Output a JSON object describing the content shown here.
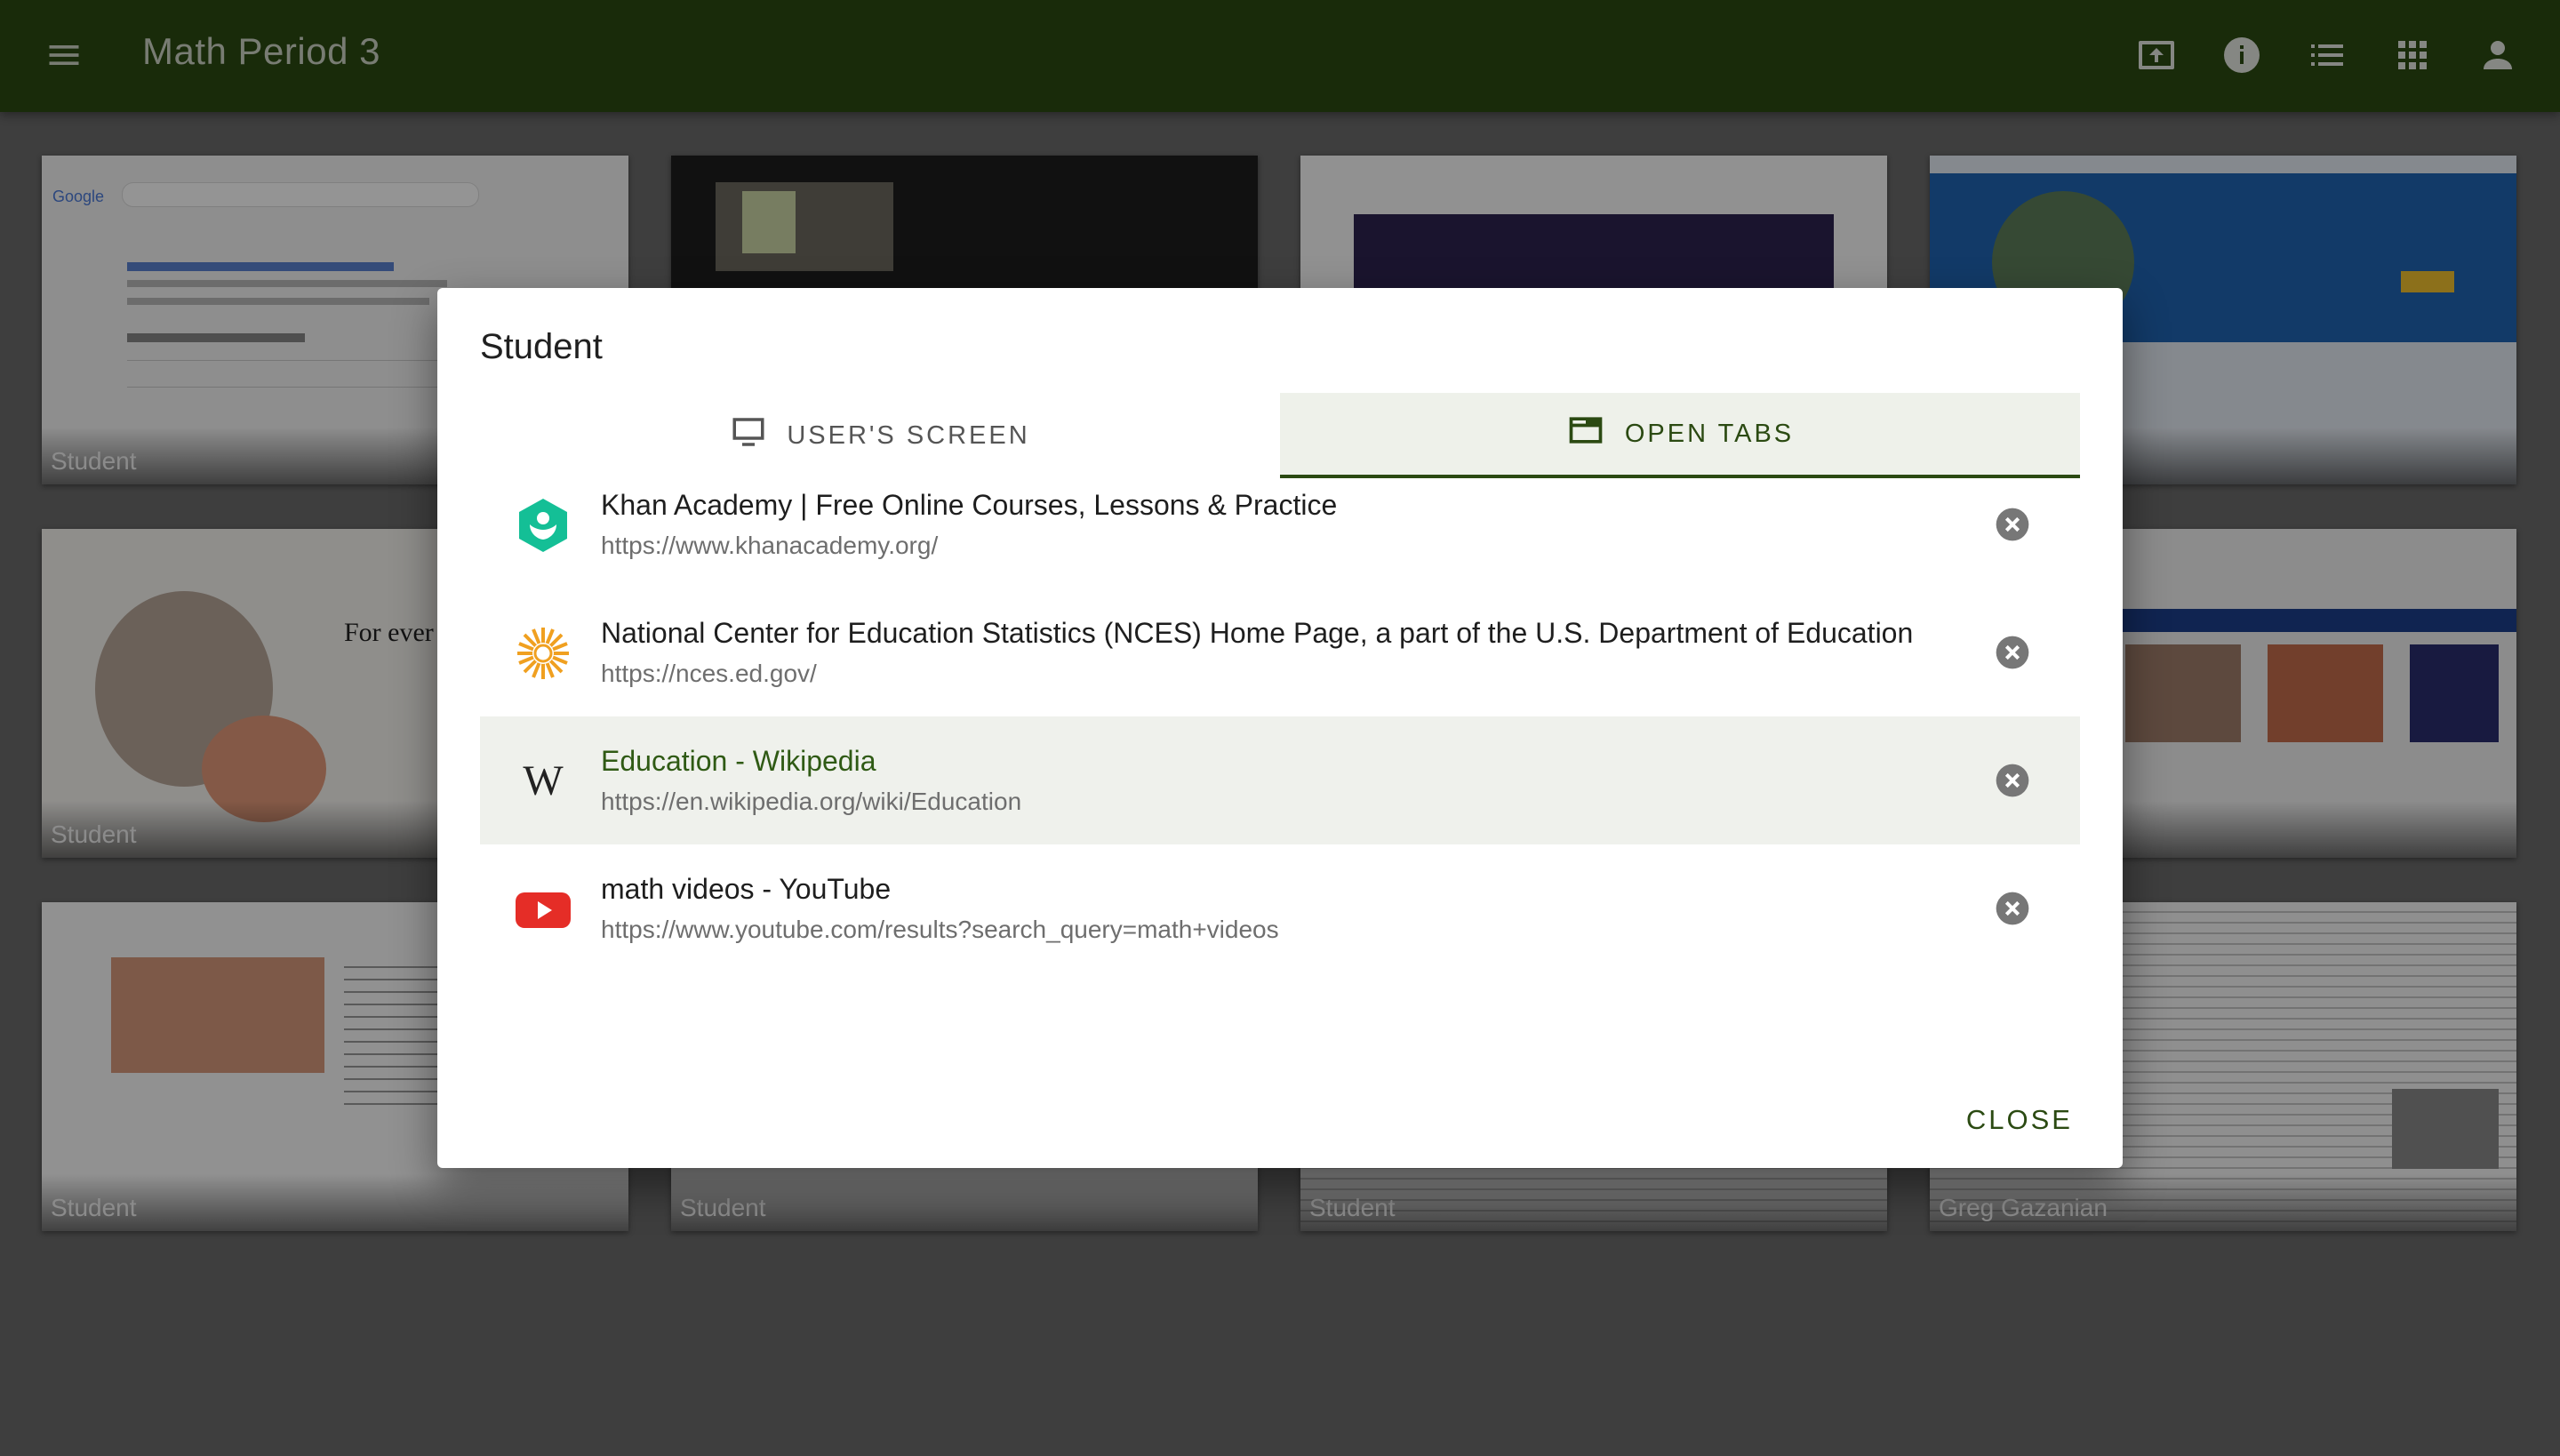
{
  "appbar": {
    "title": "Math Period 3",
    "icons": [
      "menu-icon",
      "present-screen-icon",
      "info-icon",
      "list-icon",
      "apps-grid-icon",
      "account-icon"
    ]
  },
  "tiles": [
    {
      "label": "Student",
      "thumb": "google-search-thumbnail"
    },
    {
      "label": "",
      "thumb": "youtube-video-thumbnail"
    },
    {
      "label": "",
      "thumb": "google-classroom-thumbnail"
    },
    {
      "label": "",
      "thumb": "college-board-thumbnail"
    },
    {
      "label": "Student",
      "thumb": "khan-academy-thumbnail"
    },
    {
      "label": "",
      "thumb": ""
    },
    {
      "label": "",
      "thumb": ""
    },
    {
      "label": "",
      "thumb": "nces-thumbnail"
    },
    {
      "label": "Student",
      "thumb": "edsurge-thumbnail"
    },
    {
      "label": "Student",
      "thumb": ""
    },
    {
      "label": "Student",
      "thumb": "wikipedia-thumbnail"
    },
    {
      "label": "Greg Gazanian",
      "thumb": "wikipedia-thumbnail"
    }
  ],
  "dialog": {
    "title": "Student",
    "tabs": [
      {
        "label": "USER'S SCREEN",
        "icon": "monitor-icon",
        "active": false
      },
      {
        "label": "OPEN TABS",
        "icon": "browser-tab-icon",
        "active": true
      }
    ],
    "open_tabs": [
      {
        "title": "Khan Academy | Free Online Courses, Lessons & Practice",
        "url": "https://www.khanacademy.org/",
        "icon": "khan-academy-icon",
        "selected": false
      },
      {
        "title": "National Center for Education Statistics (NCES) Home Page, a part of the U.S. Department of Education",
        "url": "https://nces.ed.gov/",
        "icon": "nces-sun-icon",
        "selected": false
      },
      {
        "title": "Education - Wikipedia",
        "url": "https://en.wikipedia.org/wiki/Education",
        "icon": "wikipedia-icon",
        "selected": true
      },
      {
        "title": "math videos - YouTube",
        "url": "https://www.youtube.com/results?search_query=math+videos",
        "icon": "youtube-icon",
        "selected": false
      }
    ],
    "close_label": "CLOSE"
  },
  "colors": {
    "appbar": "#2b4a12",
    "accent": "#2b4a12",
    "selected_row": "#eff1ec"
  }
}
